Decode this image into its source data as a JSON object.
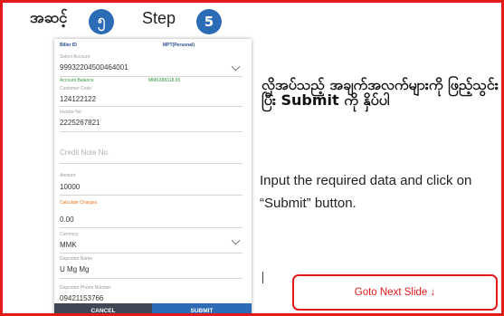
{
  "header": {
    "step_label_mm": "အဆင့်",
    "step_number_mm": "၅",
    "step_label_en": "Step",
    "step_number_en": "5"
  },
  "form": {
    "biller_id_label": "Biller ID",
    "biller_id_value": "MPT(Personal)",
    "select_account_label": "Select Account",
    "select_account_value": "99932204500464001",
    "account_balance_label": "Account Balance",
    "account_balance_value": "MMK388318.65",
    "customer_code_label": "Customer Code",
    "customer_code_value": "124122122",
    "invoice_no_label": "Invoice No",
    "invoice_no_value": "2225267821",
    "credit_note_placeholder": "Credit Note No.",
    "amount_label": "Amount",
    "amount_value": "10000",
    "calculate_charges_label": "Calculate Charges",
    "charges_value": "0.00",
    "currency_label": "Currency",
    "currency_value": "MMK",
    "depositor_name_label": "Depositor Name",
    "depositor_name_value": "U Mg Mg",
    "depositor_phone_label": "Depositor Phone Number",
    "depositor_phone_value": "09421153766",
    "cancel_label": "CANCEL",
    "submit_label": "SUBMIT"
  },
  "instructions": {
    "mm_text": "လိုအပ်သည့် အချက်အလက်များကို ဖြည့်သွင်းပြီး Submit ကို နှိပ်ပါ",
    "en_text": "Input the required data and click on “Submit” button."
  },
  "navigation": {
    "next_slide_label": "Goto Next Slide ↓"
  },
  "colors": {
    "border": "#e21a1a",
    "step_circle": "#2c6bb5",
    "submit_bar": "#2c6bb5",
    "cancel_bar": "#3f4654",
    "balance_text": "#2f9a3f",
    "orange_label": "#e8761e"
  }
}
